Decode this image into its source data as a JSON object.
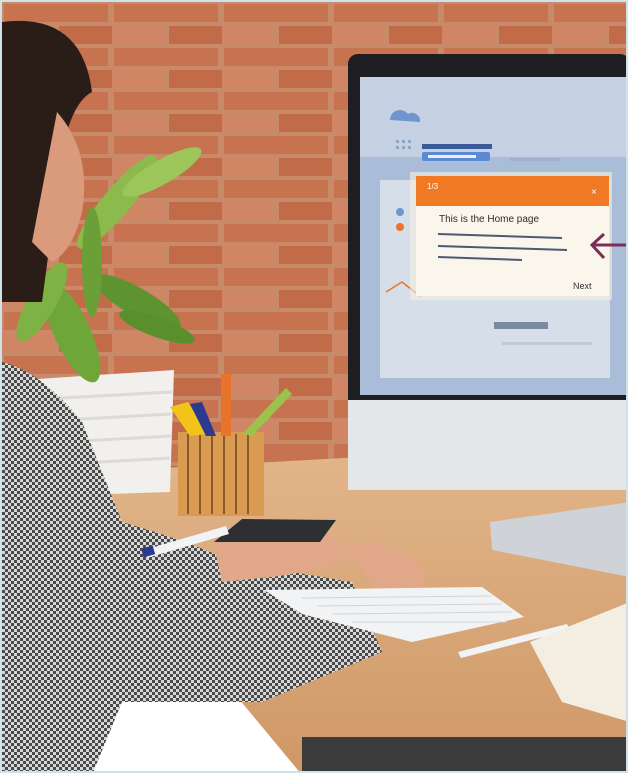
{
  "tour_popup": {
    "counter": "1/3",
    "close": "×",
    "title": "This is the Home page",
    "next": "Next"
  },
  "colors": {
    "brick": "#c8734f",
    "popup_accent": "#f07a23",
    "screen_bg": "#a9bdd8",
    "desk": "#d9a878",
    "arrow": "#7a2d55"
  }
}
